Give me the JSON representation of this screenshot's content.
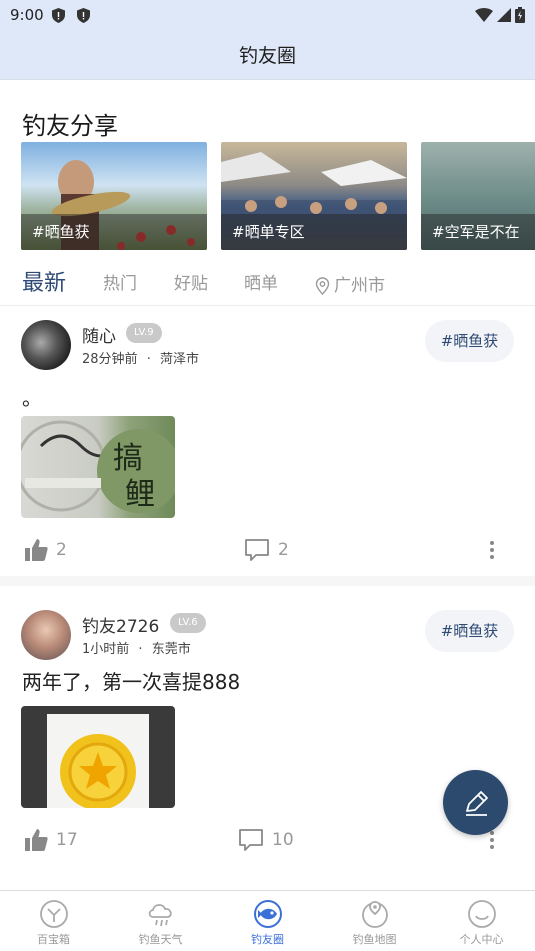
{
  "status_bar": {
    "time": "9:00"
  },
  "header": {
    "title": "钓友圈"
  },
  "share_section": {
    "title": "钓友分享",
    "cards": [
      {
        "label": "#晒鱼获"
      },
      {
        "label": "#晒单专区"
      },
      {
        "label": "#空军是不在"
      }
    ]
  },
  "tabs": [
    {
      "label": "最新",
      "active": true
    },
    {
      "label": "热门"
    },
    {
      "label": "好贴"
    },
    {
      "label": "晒单"
    },
    {
      "label": "广州市",
      "icon": "location-pin-icon"
    }
  ],
  "posts": [
    {
      "username": "随心",
      "level": "LV.9",
      "time": "28分钟前",
      "city": "菏泽市",
      "tag": "#晒鱼获",
      "text": "。",
      "likes": "2",
      "comments": "2"
    },
    {
      "username": "钓友2726",
      "level": "LV.6",
      "time": "1小时前",
      "city": "东莞市",
      "tag": "#晒鱼获",
      "text": "两年了，第一次喜提888",
      "likes": "17",
      "comments": "10"
    }
  ],
  "meta_separator": "·",
  "bottom_nav": [
    {
      "label": "百宝箱",
      "icon": "treasure-box-icon"
    },
    {
      "label": "钓鱼天气",
      "icon": "weather-icon"
    },
    {
      "label": "钓友圈",
      "icon": "fish-circle-icon",
      "active": true
    },
    {
      "label": "钓鱼地图",
      "icon": "map-pin-icon"
    },
    {
      "label": "个人中心",
      "icon": "smile-icon"
    }
  ],
  "colors": {
    "header_bg": "#dfe8f8",
    "accent": "#2f4a75",
    "nav_active": "#3a6fd8",
    "fab_bg": "#2c4a6e"
  }
}
